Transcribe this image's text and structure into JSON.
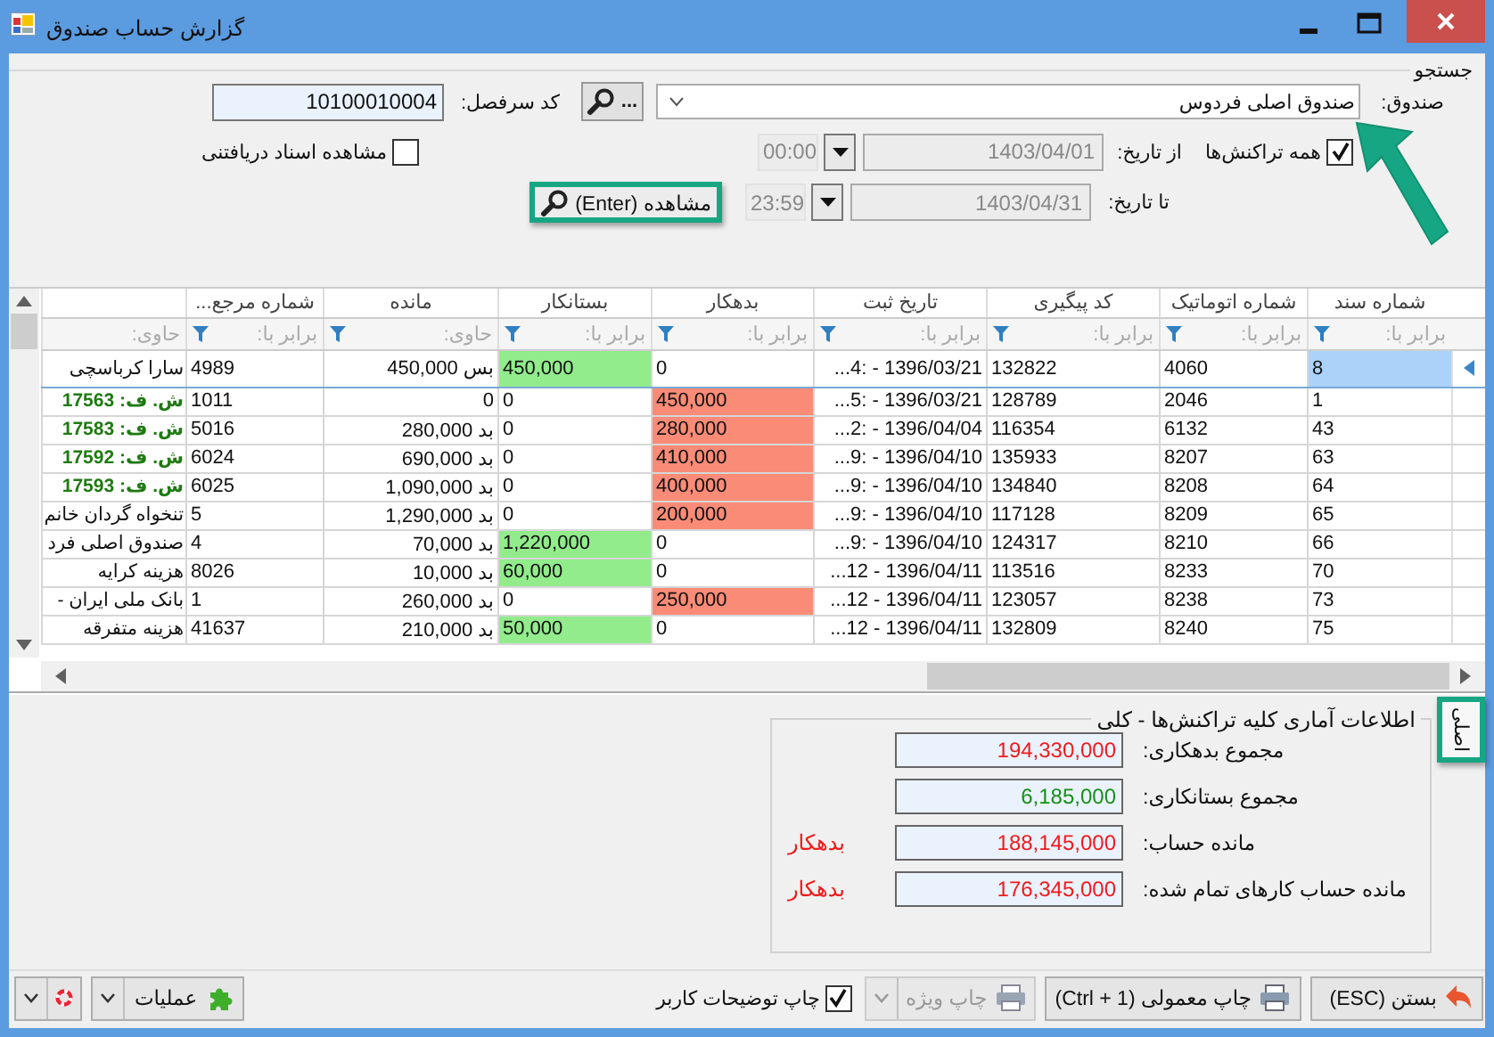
{
  "window": {
    "title": "گزارش حساب صندوق"
  },
  "search": {
    "title": "جستجو",
    "fund_label": "صندوق:",
    "fund_value": "صندوق اصلی فردوس",
    "browse_button": "...",
    "account_code_label": "کد سرفصل:",
    "account_code_value": "10100010004",
    "all_transactions": {
      "label": "همه تراکنش‌ها",
      "checked": true
    },
    "receivables": {
      "label": "مشاهده اسناد دریافتنی",
      "checked": false
    },
    "dates_disabled": true,
    "from_label": "از تاریخ:",
    "from_date": "1403/04/01",
    "from_time": "00:00",
    "to_label": "تا تاریخ:",
    "to_date": "1403/04/31",
    "to_time": "23:59",
    "view_button": "مشاهده (Enter)"
  },
  "table": {
    "columns": [
      {
        "label": "شماره سند",
        "filter": "برابر با:",
        "filter_button": true
      },
      {
        "label": "شماره اتوماتیک",
        "filter": "برابر با:",
        "filter_button": true
      },
      {
        "label": "کد پیگیری",
        "filter": "برابر با:",
        "filter_button": true
      },
      {
        "label": "تاریخ ثبت",
        "filter": "برابر با:",
        "filter_button": true
      },
      {
        "label": "بدهکار",
        "filter": "برابر با:",
        "filter_button": true
      },
      {
        "label": "بستانکار",
        "filter": "برابر با:",
        "filter_button": true
      },
      {
        "label": "مانده",
        "filter": "حاوی:",
        "filter_button": true
      },
      {
        "label": "شماره مرجع...",
        "filter": "برابر با:",
        "filter_button": true
      },
      {
        "filter": "حاوی:",
        "filter_button": false
      }
    ],
    "rows": [
      {
        "selected": true,
        "debit_highlighted": false,
        "credit_highlighted": true,
        "description_emphasized": false,
        "cells": [
          "8",
          "4060",
          "132822",
          "...4: - 1396/03/21",
          "0",
          "450,000",
          "بس 450,000",
          "4989",
          "سارا کرباسچی"
        ]
      },
      {
        "selected": false,
        "debit_highlighted": true,
        "credit_highlighted": false,
        "description_emphasized": true,
        "cells": [
          "1",
          "2046",
          "128789",
          "...5: - 1396/03/21",
          "450,000",
          "0",
          "0",
          "1011",
          "ش. ف: 17563"
        ]
      },
      {
        "selected": false,
        "debit_highlighted": true,
        "credit_highlighted": false,
        "description_emphasized": true,
        "cells": [
          "43",
          "6132",
          "116354",
          "...2: - 1396/04/04",
          "280,000",
          "0",
          "بد 280,000",
          "5016",
          "ش. ف: 17583"
        ]
      },
      {
        "selected": false,
        "debit_highlighted": true,
        "credit_highlighted": false,
        "description_emphasized": true,
        "cells": [
          "63",
          "8207",
          "135933",
          "...9: - 1396/04/10",
          "410,000",
          "0",
          "بد 690,000",
          "6024",
          "ش. ف: 17592"
        ]
      },
      {
        "selected": false,
        "debit_highlighted": true,
        "credit_highlighted": false,
        "description_emphasized": true,
        "cells": [
          "64",
          "8208",
          "134840",
          "...9: - 1396/04/10",
          "400,000",
          "0",
          "بد 1,090,000",
          "6025",
          "ش. ف: 17593"
        ]
      },
      {
        "selected": false,
        "debit_highlighted": true,
        "credit_highlighted": false,
        "description_emphasized": false,
        "cells": [
          "65",
          "8209",
          "117128",
          "...9: - 1396/04/10",
          "200,000",
          "0",
          "بد 1,290,000",
          "5",
          "تنخواه گردان خانم"
        ]
      },
      {
        "selected": false,
        "debit_highlighted": false,
        "credit_highlighted": true,
        "description_emphasized": false,
        "cells": [
          "66",
          "8210",
          "124317",
          "...9: - 1396/04/10",
          "0",
          "1,220,000",
          "بد 70,000",
          "4",
          "صندوق اصلی فرد"
        ]
      },
      {
        "selected": false,
        "debit_highlighted": false,
        "credit_highlighted": true,
        "description_emphasized": false,
        "cells": [
          "70",
          "8233",
          "113516",
          "...12 - 1396/04/11",
          "0",
          "60,000",
          "بد 10,000",
          "8026",
          "هزینه کرایه"
        ]
      },
      {
        "selected": false,
        "debit_highlighted": true,
        "credit_highlighted": false,
        "description_emphasized": false,
        "cells": [
          "73",
          "8238",
          "123057",
          "...12 - 1396/04/11",
          "250,000",
          "0",
          "بد 260,000",
          "1",
          "بانک ملی ایران -"
        ]
      },
      {
        "selected": false,
        "debit_highlighted": false,
        "credit_highlighted": true,
        "description_emphasized": false,
        "cells": [
          "75",
          "8240",
          "132809",
          "...12 - 1396/04/11",
          "0",
          "50,000",
          "بد 210,000",
          "41637",
          "هزینه متفرقه"
        ]
      }
    ]
  },
  "stats": {
    "title": "اطلاعات آماری کلیه تراکنش‌ها - کلی",
    "rows": [
      {
        "label": "مجموع بدهکاری:",
        "value": "194,330,000",
        "color": "#ef1b1b"
      },
      {
        "label": "مجموع بستانکاری:",
        "value": "6,185,000",
        "color": "#188f18"
      },
      {
        "label": "مانده حساب:",
        "value": "188,145,000",
        "color": "#ef1b1b",
        "status": "بدهکار"
      },
      {
        "label": "مانده حساب کارهای تمام شده:",
        "value": "176,345,000",
        "color": "#ef1b1b",
        "status": "بدهکار"
      }
    ]
  },
  "side_tab": {
    "label": "اصلی"
  },
  "toolbar": {
    "close_button": "بستن (ESC)",
    "print_button": "چاپ معمولی (Ctrl + 1)",
    "special_print": {
      "label": "چاپ ویژه",
      "disabled": true
    },
    "print_notes": {
      "label": "چاپ توضیحات کاربر",
      "checked": true
    },
    "actions_button": "عملیات"
  }
}
